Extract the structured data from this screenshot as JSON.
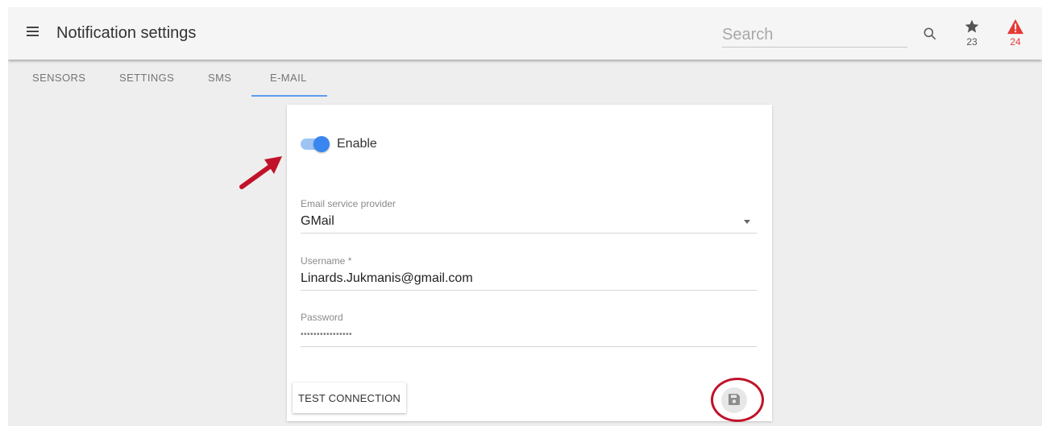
{
  "header": {
    "title": "Notification settings",
    "search_placeholder": "Search",
    "favorites_count": "23",
    "alerts_count": "24"
  },
  "tabs": [
    {
      "label": "SENSORS"
    },
    {
      "label": "SETTINGS"
    },
    {
      "label": "SMS"
    },
    {
      "label": "E-MAIL",
      "active": true
    }
  ],
  "email": {
    "enable_label": "Enable",
    "enabled": true,
    "provider_label": "Email service provider",
    "provider_value": "GMail",
    "username_label": "Username *",
    "username_value": "Linards.Jukmanis@gmail.com",
    "password_label": "Password",
    "password_value": "••••••••••••••••",
    "test_button": "TEST CONNECTION"
  },
  "colors": {
    "accent": "#3a86f0",
    "alert": "#e53935",
    "annotation": "#c0132a"
  },
  "icons": {
    "menu": "hamburger-icon",
    "search": "search-icon",
    "favorites": "star-icon",
    "alerts": "warning-icon",
    "save": "floppy-disk-icon"
  }
}
